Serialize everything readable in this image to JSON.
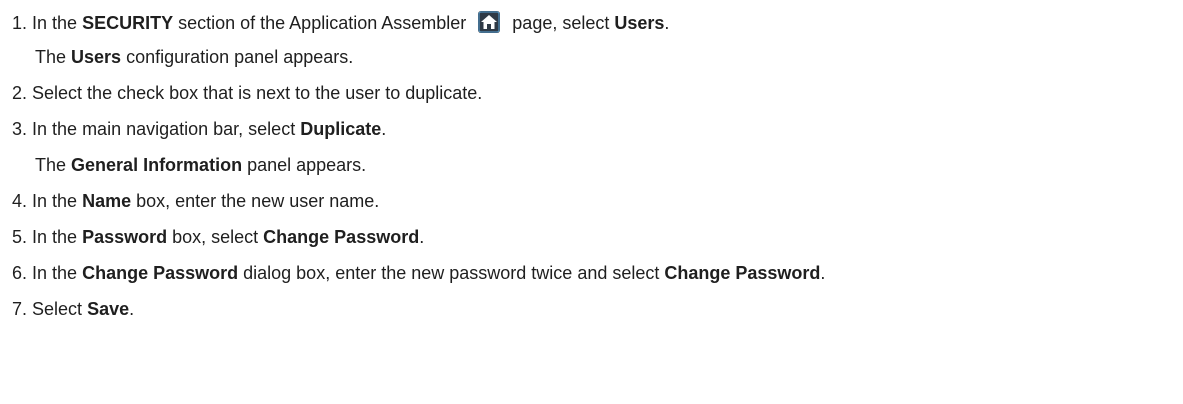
{
  "steps": [
    {
      "number": "1.",
      "parts": [
        {
          "t": "In the ",
          "b": false
        },
        {
          "t": "SECURITY",
          "b": true
        },
        {
          "t": " section of the Application Assembler ",
          "b": false
        },
        {
          "icon": "home-icon"
        },
        {
          "t": " page, select ",
          "b": false
        },
        {
          "t": "Users",
          "b": true
        },
        {
          "t": ".",
          "b": false
        }
      ],
      "note": [
        {
          "t": "The ",
          "b": false
        },
        {
          "t": "Users",
          "b": true
        },
        {
          "t": " configuration panel appears.",
          "b": false
        }
      ]
    },
    {
      "number": "2.",
      "parts": [
        {
          "t": "Select the check box that is next to the user to duplicate.",
          "b": false
        }
      ]
    },
    {
      "number": "3.",
      "parts": [
        {
          "t": "In the main navigation bar, select ",
          "b": false
        },
        {
          "t": "Duplicate",
          "b": true
        },
        {
          "t": ".",
          "b": false
        }
      ],
      "note": [
        {
          "t": "The ",
          "b": false
        },
        {
          "t": "General Information",
          "b": true
        },
        {
          "t": " panel appears.",
          "b": false
        }
      ]
    },
    {
      "number": "4.",
      "parts": [
        {
          "t": "In the ",
          "b": false
        },
        {
          "t": "Name",
          "b": true
        },
        {
          "t": " box, enter the new user name.",
          "b": false
        }
      ]
    },
    {
      "number": "5.",
      "parts": [
        {
          "t": "In the ",
          "b": false
        },
        {
          "t": "Password",
          "b": true
        },
        {
          "t": " box, select ",
          "b": false
        },
        {
          "t": "Change Password",
          "b": true
        },
        {
          "t": ".",
          "b": false
        }
      ]
    },
    {
      "number": "6.",
      "parts": [
        {
          "t": "In the ",
          "b": false
        },
        {
          "t": "Change Password",
          "b": true
        },
        {
          "t": " dialog box, enter the new password twice and select ",
          "b": false
        },
        {
          "t": "Change Password",
          "b": true
        },
        {
          "t": ".",
          "b": false
        }
      ]
    },
    {
      "number": "7.",
      "parts": [
        {
          "t": "Select ",
          "b": false
        },
        {
          "t": "Save",
          "b": true
        },
        {
          "t": ".",
          "b": false
        }
      ]
    }
  ],
  "colors": {
    "text": "#1f1f1f",
    "icon_bg": "#2f3a46",
    "icon_fg": "#ffffff"
  }
}
